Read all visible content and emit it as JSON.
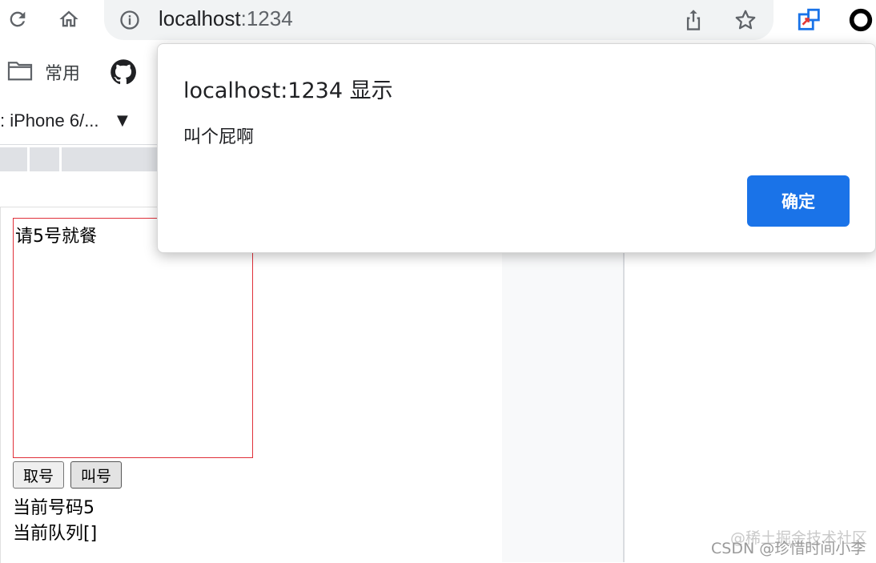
{
  "browser": {
    "url_host": "localhost",
    "url_port": ":1234",
    "bookmark_folder_label": "常用"
  },
  "devtools": {
    "device_label": ": iPhone 6/...",
    "caret": "▼"
  },
  "page": {
    "display_text": "请5号就餐",
    "take_number_button": "取号",
    "call_number_button": "叫号",
    "current_number_text": "当前号码5",
    "current_queue_text": "当前队列[]",
    "box_border_color": "#e0303a"
  },
  "dialog": {
    "title": "localhost:1234 显示",
    "message": "叫个屁啊",
    "ok_label": "确定",
    "ok_color": "#1a73e8"
  },
  "watermark": {
    "line1": "@稀土掘金技术社区",
    "line2": "CSDN @珍惜时间小李"
  }
}
